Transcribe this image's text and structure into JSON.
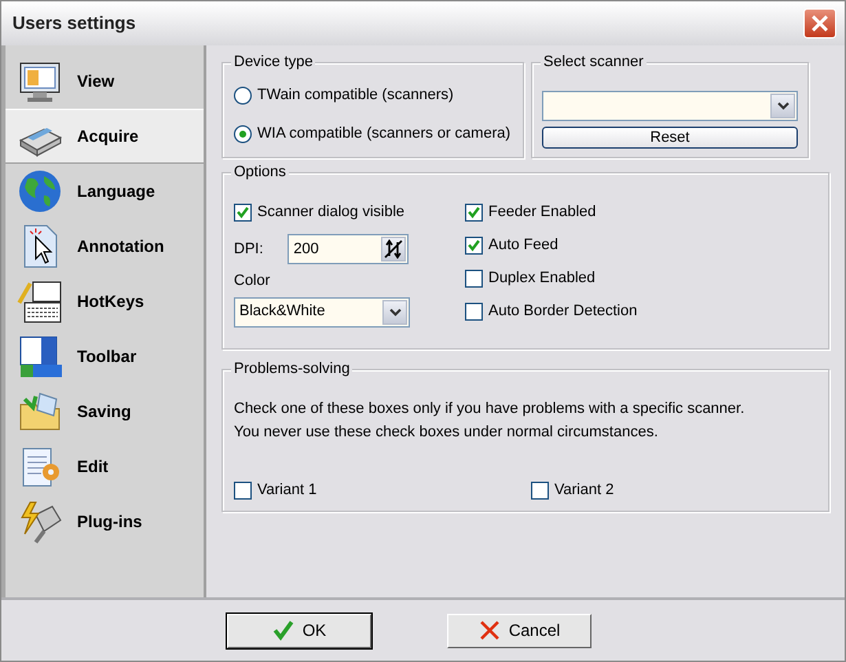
{
  "window": {
    "title": "Users settings"
  },
  "sidebar": {
    "items": [
      {
        "label": "View",
        "kind": "monitor",
        "selected": false
      },
      {
        "label": "Acquire",
        "kind": "scanner",
        "selected": true
      },
      {
        "label": "Language",
        "kind": "globe",
        "selected": false
      },
      {
        "label": "Annotation",
        "kind": "pointer",
        "selected": false
      },
      {
        "label": "HotKeys",
        "kind": "keyboard",
        "selected": false
      },
      {
        "label": "Toolbar",
        "kind": "taskbar",
        "selected": false
      },
      {
        "label": "Saving",
        "kind": "folder",
        "selected": false
      },
      {
        "label": "Edit",
        "kind": "notepad",
        "selected": false
      },
      {
        "label": "Plug-ins",
        "kind": "plug",
        "selected": false
      }
    ]
  },
  "device_type": {
    "legend": "Device type",
    "options": [
      {
        "label": "TWain compatible (scanners)",
        "selected": false
      },
      {
        "label": "WIA compatible (scanners or camera)",
        "selected": true
      }
    ]
  },
  "select_scanner": {
    "legend": "Select scanner",
    "button": "Reset"
  },
  "options": {
    "legend": "Options",
    "left_checkboxes": [
      {
        "label": "Scanner dialog visible",
        "checked": true
      }
    ],
    "dpi": {
      "label": "DPI:",
      "value": "200"
    },
    "color": {
      "label": "Color",
      "value": "Black&White"
    },
    "right_checkboxes": [
      {
        "label": "Feeder Enabled",
        "checked": true
      },
      {
        "label": "Auto Feed",
        "checked": true
      },
      {
        "label": "Duplex Enabled",
        "checked": false
      },
      {
        "label": "Auto Border Detection",
        "checked": false
      }
    ]
  },
  "problems_solving": {
    "legend": "Problems-solving",
    "lines": [
      "Check one of these boxes only if you have problems with a specific scanner.",
      "You never use these check boxes under normal circumstances."
    ],
    "checkboxes": [
      {
        "label": "Variant 1",
        "checked": false
      },
      {
        "label": "Variant 2",
        "checked": false
      }
    ]
  },
  "buttons": [
    {
      "label": "OK",
      "kind": "ok",
      "default": true
    },
    {
      "label": "Cancel",
      "kind": "cancel",
      "default": false
    }
  ]
}
